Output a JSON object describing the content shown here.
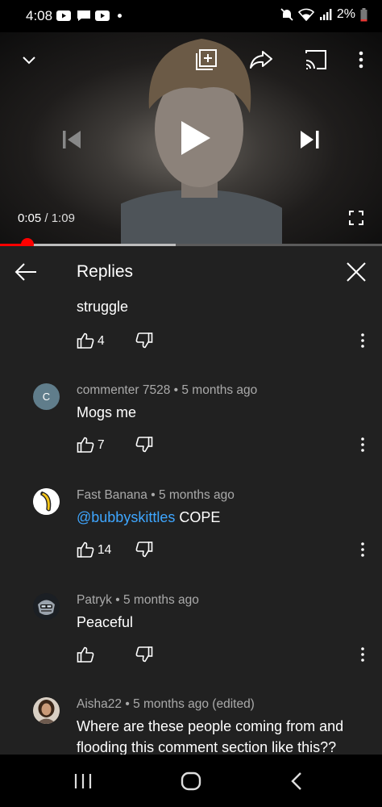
{
  "status_bar": {
    "time": "4:08",
    "battery": "2%",
    "icons": [
      "youtube-notification-icon",
      "message-notification-icon",
      "youtube-notification-icon",
      "mute-icon",
      "wifi-icon",
      "signal-icon",
      "battery-low-icon"
    ]
  },
  "player": {
    "current_time": "0:05",
    "separator": " / ",
    "duration": "1:09",
    "progress_played": 0.072,
    "progress_buffered": 0.46,
    "icons": [
      "chevron-down-icon",
      "add-to-playlist-icon",
      "share-icon",
      "cast-icon",
      "more-vert-icon",
      "previous-icon",
      "play-icon",
      "next-icon",
      "fullscreen-icon"
    ],
    "accent_color": "#ff0000"
  },
  "replies_panel": {
    "title": "Replies",
    "back_icon": "arrow-back-icon",
    "close_icon": "close-icon"
  },
  "comments": [
    {
      "author": "",
      "time": "",
      "text": "struggle",
      "likes": "4"
    },
    {
      "author": "commenter 7528",
      "time": "5 months ago",
      "avatar_letter": "C",
      "avatar_color": "#607d8b",
      "text": "Mogs me",
      "likes": "7"
    },
    {
      "author": "Fast Banana",
      "time": "5 months ago",
      "avatar_icon": "banana-avatar-icon",
      "mention": "@bubbyskittles",
      "text": " COPE",
      "likes": "14"
    },
    {
      "author": "Patryk",
      "time": "5 months ago",
      "avatar_icon": "robot-avatar-icon",
      "text": "Peaceful",
      "likes": ""
    },
    {
      "author": "Aisha22",
      "time": "5 months ago (edited)",
      "avatar_icon": "person-photo-avatar",
      "text": "Where are these people coming from and flooding this comment section like this??",
      "likes": ""
    }
  ],
  "meta_separator": " • ",
  "nav_bar": {
    "icons": [
      "recent-apps-icon",
      "home-icon",
      "back-icon"
    ]
  }
}
